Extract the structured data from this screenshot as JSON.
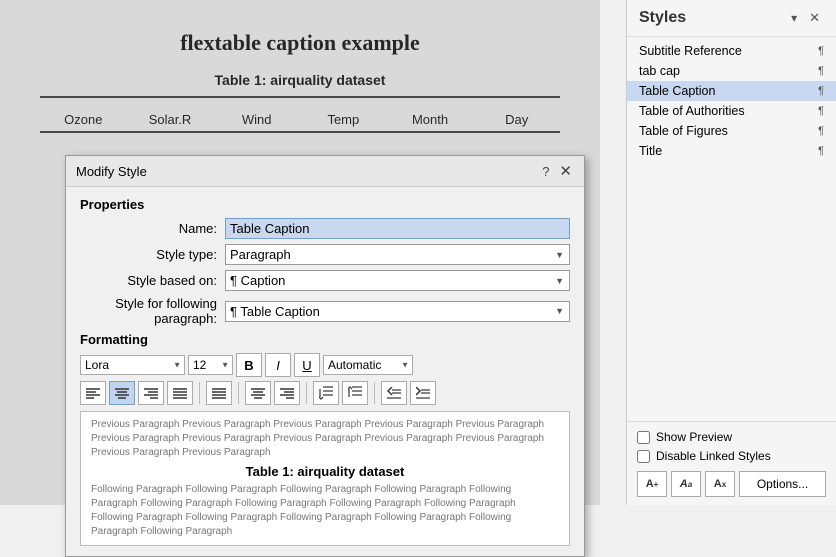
{
  "document": {
    "title": "flextable caption example",
    "table_title": "Table 1: airquality dataset",
    "table_headers": [
      "Ozone",
      "Solar.R",
      "Wind",
      "Temp",
      "Month",
      "Day"
    ]
  },
  "styles_panel": {
    "title": "Styles",
    "items": [
      {
        "name": "Subtitle Reference",
        "icon": "¶",
        "selected": false
      },
      {
        "name": "tab cap",
        "icon": "¶",
        "selected": false
      },
      {
        "name": "Table Caption",
        "icon": "¶",
        "selected": true
      },
      {
        "name": "Table of Authorities",
        "icon": "¶",
        "selected": false
      },
      {
        "name": "Table of Figures",
        "icon": "¶",
        "selected": false
      },
      {
        "name": "Title",
        "icon": "¶",
        "selected": false
      }
    ],
    "show_preview_label": "Show Preview",
    "disable_linked_label": "Disable Linked Styles",
    "options_button_label": "Options...",
    "btn_new": "A",
    "btn_style": "A",
    "btn_clear": "A"
  },
  "dialog": {
    "title": "Modify Style",
    "help_label": "?",
    "close_label": "✕",
    "properties_label": "Properties",
    "name_label": "Name:",
    "name_value": "Table Caption",
    "style_type_label": "Style type:",
    "style_type_value": "Paragraph",
    "style_based_label": "Style based on:",
    "style_based_value": "Caption",
    "style_based_icon": "¶",
    "style_following_label": "Style for following paragraph:",
    "style_following_value": "Table Caption",
    "style_following_icon": "¶",
    "formatting_label": "Formatting",
    "font_value": "Lora",
    "size_value": "12",
    "bold_label": "B",
    "italic_label": "I",
    "underline_label": "U",
    "color_value": "Automatic",
    "align_left": "≡",
    "align_center": "≡",
    "align_right": "≡",
    "align_justify": "≡",
    "align_indent_left": "≡",
    "align_indent_center": "≡",
    "align_indent_right": "≡",
    "spacing_decrease": "↕",
    "spacing_increase": "↕",
    "indent_decrease": "⇤",
    "indent_increase": "⇥",
    "preview_prev": "Previous Paragraph Previous Paragraph Previous Paragraph Previous Paragraph Previous Paragraph Previous Paragraph Previous Paragraph Previous Paragraph Previous Paragraph Previous Paragraph Previous Paragraph Previous Paragraph",
    "preview_main": "Table 1: airquality dataset",
    "preview_follow": "Following Paragraph Following Paragraph Following Paragraph Following Paragraph Following Paragraph Following Paragraph Following Paragraph Following Paragraph Following Paragraph Following Paragraph Following Paragraph Following Paragraph Following Paragraph Following Paragraph Following Paragraph"
  }
}
